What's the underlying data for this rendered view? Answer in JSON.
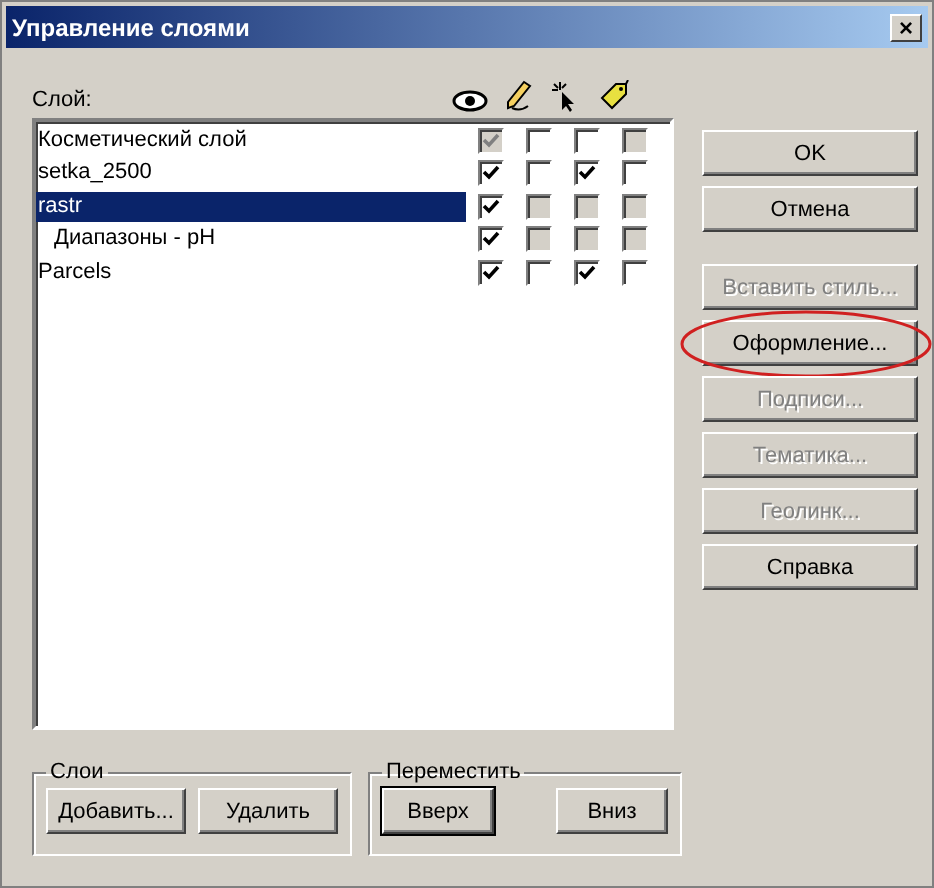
{
  "window": {
    "title": "Управление слоями",
    "close": "×"
  },
  "list": {
    "label": "Слой:",
    "rows": [
      {
        "name": "Косметический слой",
        "selected": false,
        "flags": [
          {
            "checked": true,
            "disabled": true
          },
          {
            "checked": false,
            "disabled": false
          },
          {
            "checked": false,
            "disabled": false
          },
          {
            "checked": false,
            "disabled": true
          }
        ]
      },
      {
        "name": "setka_2500",
        "selected": false,
        "flags": [
          {
            "checked": true,
            "disabled": false
          },
          {
            "checked": false,
            "disabled": false
          },
          {
            "checked": true,
            "disabled": false
          },
          {
            "checked": false,
            "disabled": false
          }
        ]
      },
      {
        "name": "rastr",
        "selected": true,
        "flags": [
          {
            "checked": true,
            "disabled": false
          },
          {
            "checked": false,
            "disabled": true
          },
          {
            "checked": false,
            "disabled": true
          },
          {
            "checked": false,
            "disabled": true
          }
        ],
        "children": [
          {
            "name": "Диапазоны - pH",
            "selected": false,
            "flags": [
              {
                "checked": true,
                "disabled": false
              },
              {
                "checked": false,
                "disabled": true
              },
              {
                "checked": false,
                "disabled": true
              },
              {
                "checked": false,
                "disabled": true
              }
            ]
          }
        ]
      },
      {
        "name": "Parcels",
        "selected": false,
        "flags": [
          {
            "checked": true,
            "disabled": false
          },
          {
            "checked": false,
            "disabled": false
          },
          {
            "checked": true,
            "disabled": false
          },
          {
            "checked": false,
            "disabled": false
          }
        ]
      }
    ]
  },
  "main_buttons": [
    {
      "label": "OK",
      "disabled": false,
      "circled": false
    },
    {
      "label": "Отмена",
      "disabled": false,
      "circled": false
    }
  ],
  "tool_buttons": [
    {
      "label": "Вставить стиль...",
      "disabled": true,
      "circled": false
    },
    {
      "label": "Оформление...",
      "disabled": false,
      "circled": true
    },
    {
      "label": "Подписи...",
      "disabled": true,
      "circled": false
    },
    {
      "label": "Тематика...",
      "disabled": true,
      "circled": false
    },
    {
      "label": "Геолинк...",
      "disabled": true,
      "circled": false
    },
    {
      "label": "Справка",
      "disabled": false,
      "circled": false
    }
  ],
  "groups": [
    {
      "title": "Слои",
      "buttons": [
        {
          "label": "Добавить...",
          "focused": false
        },
        {
          "label": "Удалить",
          "focused": false
        }
      ]
    },
    {
      "title": "Переместить",
      "buttons": [
        {
          "label": "Вверх",
          "focused": true
        },
        {
          "label": "Вниз",
          "focused": false
        }
      ]
    }
  ]
}
